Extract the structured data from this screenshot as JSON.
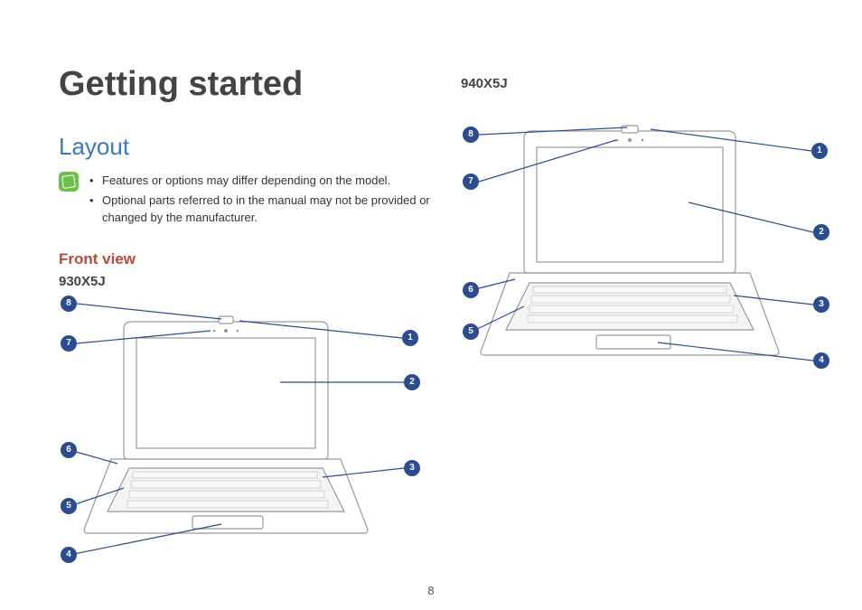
{
  "heading": "Getting started",
  "section": "Layout",
  "notes": {
    "item1": "Features or options may differ depending on the model.",
    "item2": "Optional parts referred to in the manual may not be provided or changed by the manufacturer."
  },
  "front_view": "Front view",
  "model_a": "930X5J",
  "model_b": "940X5J",
  "callouts": {
    "c1": "1",
    "c2": "2",
    "c3": "3",
    "c4": "4",
    "c5": "5",
    "c6": "6",
    "c7": "7",
    "c8": "8"
  },
  "page_number": "8"
}
